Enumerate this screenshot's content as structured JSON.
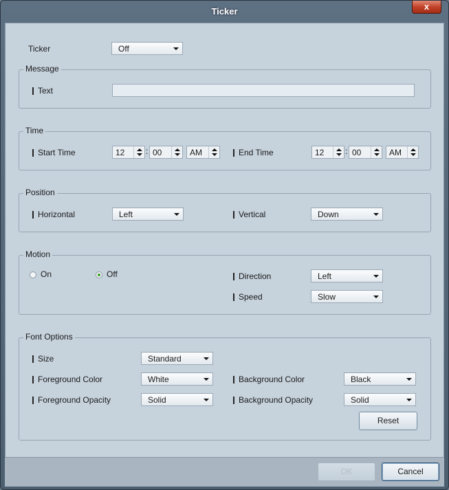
{
  "window": {
    "title": "Ticker",
    "close_label": "x"
  },
  "ticker": {
    "label": "Ticker",
    "value": "Off"
  },
  "message": {
    "legend": "Message",
    "text_label": "Text",
    "text_value": ""
  },
  "time": {
    "legend": "Time",
    "start_label": "Start Time",
    "start_hour": "12",
    "start_minute": "00",
    "start_ampm": "AM",
    "end_label": "End Time",
    "end_hour": "12",
    "end_minute": "00",
    "end_ampm": "AM",
    "separator": ":"
  },
  "position": {
    "legend": "Position",
    "horizontal_label": "Horizontal",
    "horizontal_value": "Left",
    "vertical_label": "Vertical",
    "vertical_value": "Down"
  },
  "motion": {
    "legend": "Motion",
    "on_label": "On",
    "off_label": "Off",
    "selected": "Off",
    "direction_label": "Direction",
    "direction_value": "Left",
    "speed_label": "Speed",
    "speed_value": "Slow"
  },
  "font_options": {
    "legend": "Font Options",
    "size_label": "Size",
    "size_value": "Standard",
    "fg_color_label": "Foreground Color",
    "fg_color_value": "White",
    "bg_color_label": "Background Color",
    "bg_color_value": "Black",
    "fg_opacity_label": "Foreground Opacity",
    "fg_opacity_value": "Solid",
    "bg_opacity_label": "Background Opacity",
    "bg_opacity_value": "Solid",
    "reset_label": "Reset"
  },
  "footer": {
    "ok_label": "OK",
    "cancel_label": "Cancel"
  },
  "colors": {
    "titlebar": "#5d7183",
    "client": "#c6d2dc",
    "close": "#c2432a",
    "radio_selected": "#3a9a2e"
  }
}
